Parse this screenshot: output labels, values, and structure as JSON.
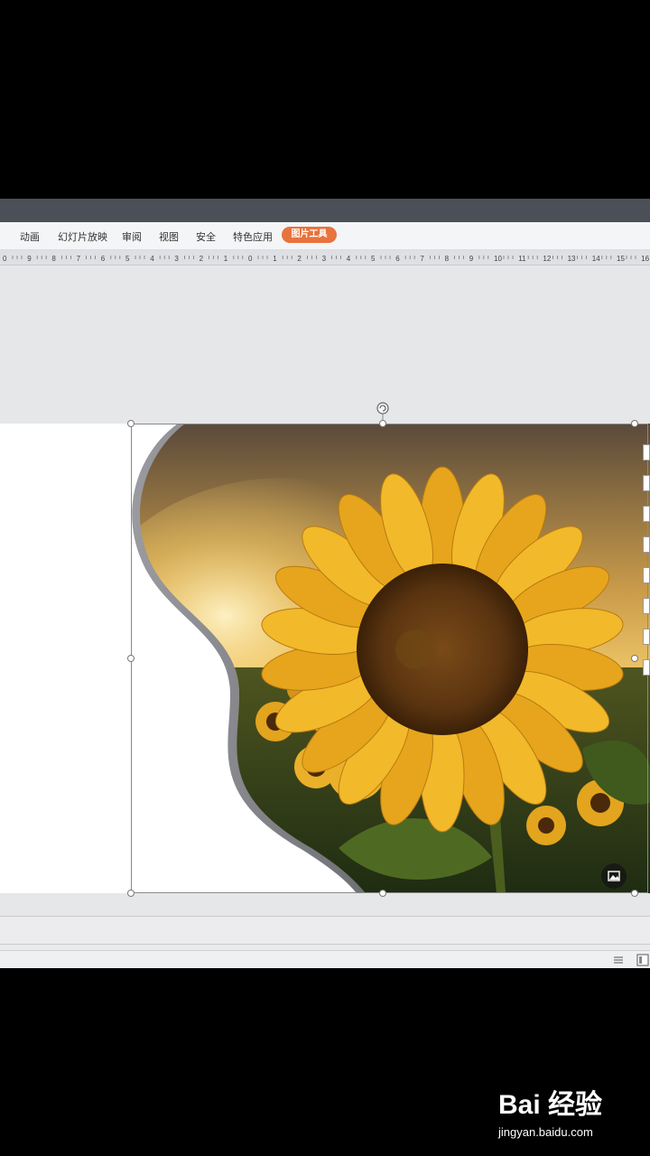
{
  "menu": {
    "items": [
      {
        "label": "动画"
      },
      {
        "label": "幻灯片放映"
      },
      {
        "label": "审阅"
      },
      {
        "label": "视图"
      },
      {
        "label": "安全"
      },
      {
        "label": "特色应用"
      }
    ],
    "active_tab": "图片工具",
    "active_color": "#e8733d"
  },
  "ruler": {
    "labels": [
      "0",
      "9",
      "8",
      "7",
      "6",
      "5",
      "4",
      "3",
      "2",
      "1",
      "0",
      "1",
      "2",
      "3",
      "4",
      "5",
      "6",
      "7",
      "8",
      "9",
      "10",
      "11",
      "12",
      "13",
      "14",
      "15",
      "16"
    ]
  },
  "slide": {
    "image_subject": "sunflower-field-at-sunset",
    "shape": "wave-curve-crop"
  },
  "watermark": {
    "logo": "Bai 经验",
    "site": "jingyan.baidu.com"
  },
  "icons": {
    "rotate": "rotate-icon",
    "picture": "picture-icon"
  }
}
